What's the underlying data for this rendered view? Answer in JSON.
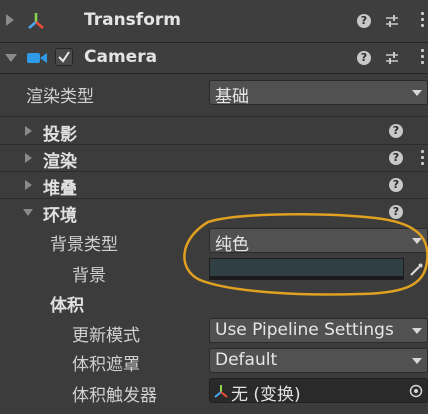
{
  "transform": {
    "title": "Transform"
  },
  "camera": {
    "title": "Camera",
    "enabled": true,
    "render_type_label": "渲染类型",
    "render_type_value": "基础"
  },
  "sections": {
    "projection": "投影",
    "rendering": "渲染",
    "stack": "堆叠",
    "environment": "环境"
  },
  "environment": {
    "background_type_label": "背景类型",
    "background_type_value": "纯色",
    "background_label": "背景",
    "background_color": "#2f3f43"
  },
  "volume": {
    "heading": "体积",
    "update_mode_label": "更新模式",
    "update_mode_value": "Use Pipeline Settings",
    "mask_label": "体积遮罩",
    "mask_value": "Default",
    "trigger_label": "体积触发器",
    "trigger_value": "无 (变换)"
  },
  "colors": {
    "annotation": "#e0a020"
  }
}
